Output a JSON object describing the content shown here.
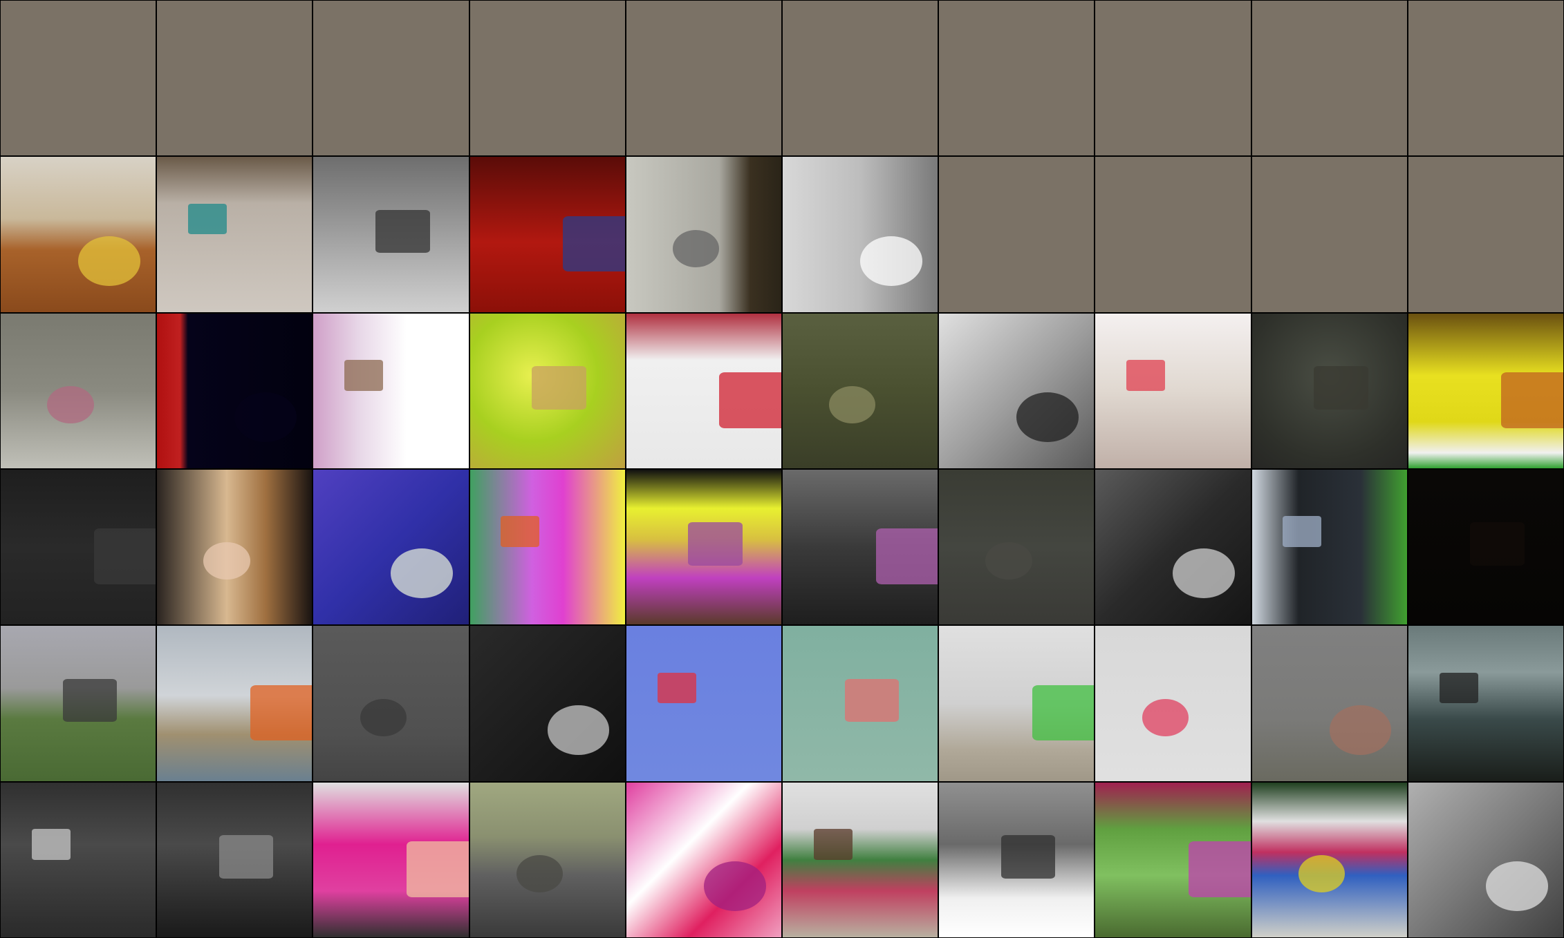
{
  "grid": {
    "rows": 6,
    "cols": 10,
    "placeholder_color": "#7b7266",
    "tiles": [
      [
        "placeholder",
        "placeholder",
        "placeholder",
        "placeholder",
        "placeholder",
        "placeholder",
        "placeholder",
        "placeholder",
        "placeholder",
        "placeholder"
      ],
      [
        {
          "name": "kitchen-table-photo",
          "bg": "linear-gradient(180deg,#d8d2c6 0%,#c9b89a 40%,#a8622a 60%,#8a4a1c 100%)",
          "accent": "#e3c23a"
        },
        {
          "name": "luggage-floor-photo",
          "bg": "linear-gradient(180deg,#6a5a48 0%,#b9b0a6 30%,#cfc8c0 100%)",
          "accent": "#1f8a8a"
        },
        {
          "name": "birthday-cake-grayscale-photo",
          "bg": "linear-gradient(180deg,#6e6e6e 0%,#9a9a9a 45%,#d0d0d0 100%)",
          "accent": "#333333"
        },
        {
          "name": "red-tile-floor-photo",
          "bg": "linear-gradient(180deg,#5a0c08 0%,#b21810 55%,#8c1008 100%)",
          "accent": "#2a3c8a"
        },
        {
          "name": "refrigerator-photo",
          "bg": "linear-gradient(90deg,#c8c8c0 0%,#a9a8a0 60%,#3a3020 80%,#2a2418 100%)",
          "accent": "#666666"
        },
        {
          "name": "white-cabinets-photo",
          "bg": "linear-gradient(90deg,#d8d8d8 0%,#bdbdbd 50%,#7a7a7a 100%)",
          "accent": "#ffffff"
        },
        "placeholder",
        "placeholder",
        "placeholder",
        "placeholder"
      ],
      [
        {
          "name": "donut-child-photo",
          "bg": "linear-gradient(180deg,#7a7a70 0%,#8a8a80 50%,#c0c0b8 100%)",
          "accent": "#b06a80"
        },
        {
          "name": "neon-sign-dark-photo",
          "bg": "linear-gradient(90deg,#b01010 0%,#c02020 15%,#05031a 20%,#02010f 100%)",
          "accent": "#05031a"
        },
        {
          "name": "bright-blur-flowers-photo",
          "bg": "linear-gradient(90deg,#d0a0c8 0%,#e8d8e8 30%,#ffffff 60%,#ffffff 100%)",
          "accent": "#8c6a50"
        },
        {
          "name": "green-texture-photo",
          "bg": "radial-gradient(circle at 40% 40%,#e8f050 0%,#a8d020 50%,#c0a040 100%)",
          "accent": "#c8a060"
        },
        {
          "name": "strawberry-cake-photo",
          "bg": "linear-gradient(180deg,#b03040 0%,#f0f0f0 30%,#e8e8e8 100%)",
          "accent": "#d02030"
        },
        {
          "name": "pizza-dark-photo",
          "bg": "linear-gradient(180deg,#5a6040 0%,#4a5030 50%,#3a3e28 100%)",
          "accent": "#8a8a60"
        },
        {
          "name": "banana-grayscale-photo",
          "bg": "linear-gradient(135deg,#e0e0e0 0%,#a0a0a0 50%,#5a5a5a 100%)",
          "accent": "#202020"
        },
        {
          "name": "dessert-bright-photo",
          "bg": "linear-gradient(180deg,#f4f0f0 0%,#e0d8d0 50%,#c0b0a8 100%)",
          "accent": "#e04050"
        },
        {
          "name": "dark-bowl-photo",
          "bg": "radial-gradient(circle at 50% 40%,#4a4e44 0%,#2e302a 70%,#262624 100%)",
          "accent": "#3a3a32"
        },
        {
          "name": "yellow-cake-photo",
          "bg": "linear-gradient(180deg,#6a5010 0%,#e8e020 40%,#e0d818 70%,#f0f0f0 90%,#30a030 100%)",
          "accent": "#c06020"
        }
      ],
      [
        {
          "name": "dark-tie-photo",
          "bg": "linear-gradient(180deg,#1e1e1e 0%,#2a2a2a 50%,#222222 100%)",
          "accent": "#3a3a3a"
        },
        {
          "name": "prom-couple-photo",
          "bg": "linear-gradient(90deg,#2a2420 0%,#d8b890 45%,#a07040 70%,#1a1412 100%)",
          "accent": "#e8c8b0"
        },
        {
          "name": "purple-shirt-selfie-photo",
          "bg": "linear-gradient(135deg,#5040c0 0%,#3030a8 50%,#202078 100%)",
          "accent": "#e0e8d8"
        },
        {
          "name": "man-pink-shirt-photo",
          "bg": "linear-gradient(90deg,#40a060 0%,#d060e0 40%,#e040d0 60%,#f0f040 100%)",
          "accent": "#e06020"
        },
        {
          "name": "man-hat-yellow-photo",
          "bg": "linear-gradient(180deg,#101010 0%,#e8f030 25%,#d8c040 45%,#c040c0 70%,#5a3a2a 100%)",
          "accent": "#9a4aa0"
        },
        {
          "name": "phone-call-photo",
          "bg": "linear-gradient(180deg,#6a6a6a 0%,#3a3a3a 50%,#1e1e1e 100%)",
          "accent": "#b060b0"
        },
        {
          "name": "shirt-dim-photo",
          "bg": "linear-gradient(180deg,#3a3c34 0%,#444640 50%,#3a3a36 100%)",
          "accent": "#4a4a44"
        },
        {
          "name": "man-tie-closeup-photo",
          "bg": "linear-gradient(135deg,#5a5a5a 0%,#2a2a2a 50%,#151515 100%)",
          "accent": "#d0d0d0"
        },
        {
          "name": "suit-groom-photo",
          "bg": "linear-gradient(90deg,#d0d8e0 0%,#202428 30%,#2a3038 70%,#40a030 100%)",
          "accent": "#a0b0c8"
        },
        {
          "name": "black-dark-photo",
          "bg": "linear-gradient(180deg,#0a0806 0%,#060504 100%)",
          "accent": "#120c08"
        }
      ],
      [
        {
          "name": "park-kites-photo",
          "bg": "linear-gradient(180deg,#a8a8b0 0%,#9a9a9a 40%,#5a7a40 60%,#4a6a34 100%)",
          "accent": "#3a3a3a"
        },
        {
          "name": "beach-kites-photo",
          "bg": "linear-gradient(180deg,#b0b8c0 0%,#d0d4d8 45%,#a09070 70%,#6a8090 100%)",
          "accent": "#e06020"
        },
        {
          "name": "gray-haze-photo",
          "bg": "linear-gradient(180deg,#5a5a5a 0%,#505050 70%,#444444 100%)",
          "accent": "#3a3a3a"
        },
        {
          "name": "kite-closeup-photo",
          "bg": "linear-gradient(135deg,#2a2a2a 0%,#1a1a1a 60%,#101010 100%)",
          "accent": "#c8c8c8"
        },
        {
          "name": "blue-sky-kite-photo",
          "bg": "linear-gradient(180deg,#6a80e0 0%,#7088e0 100%)",
          "accent": "#e03040"
        },
        {
          "name": "teal-sky-kite-photo",
          "bg": "linear-gradient(180deg,#80b0a0 0%,#90b8a8 100%)",
          "accent": "#e07070"
        },
        {
          "name": "boy-green-shirt-photo",
          "bg": "linear-gradient(180deg,#e0e0e0 0%,#d0d0d0 50%,#b0a898 80%,#a09888 100%)",
          "accent": "#40c040"
        },
        {
          "name": "pale-sky-kite-photo",
          "bg": "linear-gradient(180deg,#d8d8d8 0%,#e0e0e0 100%)",
          "accent": "#e04060"
        },
        {
          "name": "foggy-beach-photo",
          "bg": "linear-gradient(180deg,#808080 0%,#7a7a78 60%,#6a6a60 100%)",
          "accent": "#a07060"
        },
        {
          "name": "stormy-kites-photo",
          "bg": "linear-gradient(180deg,#6a7a7a 0%,#8a9a9a 30%,#3a4a4a 60%,#1a1e1a 100%)",
          "accent": "#202020"
        }
      ],
      [
        {
          "name": "bus-window-photo",
          "bg": "linear-gradient(180deg,#303030 0%,#4a4a4a 40%,#2a2a2a 100%)",
          "accent": "#c8c8c8"
        },
        {
          "name": "night-bus-photo",
          "bg": "linear-gradient(180deg,#303030 0%,#4a4a4a 40%,#1a1a1a 100%)",
          "accent": "#8a8a8a"
        },
        {
          "name": "pink-car-photo",
          "bg": "linear-gradient(180deg,#e0e0e0 0%,#e02090 40%,#e040a0 70%,#303030 100%)",
          "accent": "#f0c0a0"
        },
        {
          "name": "cat-engine-photo",
          "bg": "linear-gradient(180deg,#a0a880 0%,#8a9070 35%,#606060 60%,#3a3a3a 100%)",
          "accent": "#4a4a44"
        },
        {
          "name": "magenta-motorcycle-photo",
          "bg": "linear-gradient(135deg,#e040a0 0%,#ffffff 40%,#e02060 70%,#f0a0c0 100%)",
          "accent": "#a02080"
        },
        {
          "name": "park-bench-photo",
          "bg": "linear-gradient(180deg,#e0e0e0 0%,#d0d0d0 30%,#408040 50%,#c04060 70%,#b8b0a0 100%)",
          "accent": "#5a3a2a"
        },
        {
          "name": "white-van-photo",
          "bg": "linear-gradient(180deg,#909090 0%,#6a6a6a 40%,#f0f0f0 75%,#ffffff 100%)",
          "accent": "#303030"
        },
        {
          "name": "green-doors-moped-photo",
          "bg": "linear-gradient(180deg,#a02050 0%,#60a040 30%,#80c060 60%,#4a6a30 100%)",
          "accent": "#c040b0"
        },
        {
          "name": "striped-blankets-photo",
          "bg": "linear-gradient(180deg,#204020 0%,#e0e0e0 25%,#c03060 45%,#3060c0 60%,#d0d0c8 100%)",
          "accent": "#e0d020"
        },
        {
          "name": "street-bus-grayscale-photo",
          "bg": "linear-gradient(135deg,#b0b0b0 0%,#7a7a7a 50%,#404040 100%)",
          "accent": "#e0e0e0"
        }
      ]
    ]
  }
}
